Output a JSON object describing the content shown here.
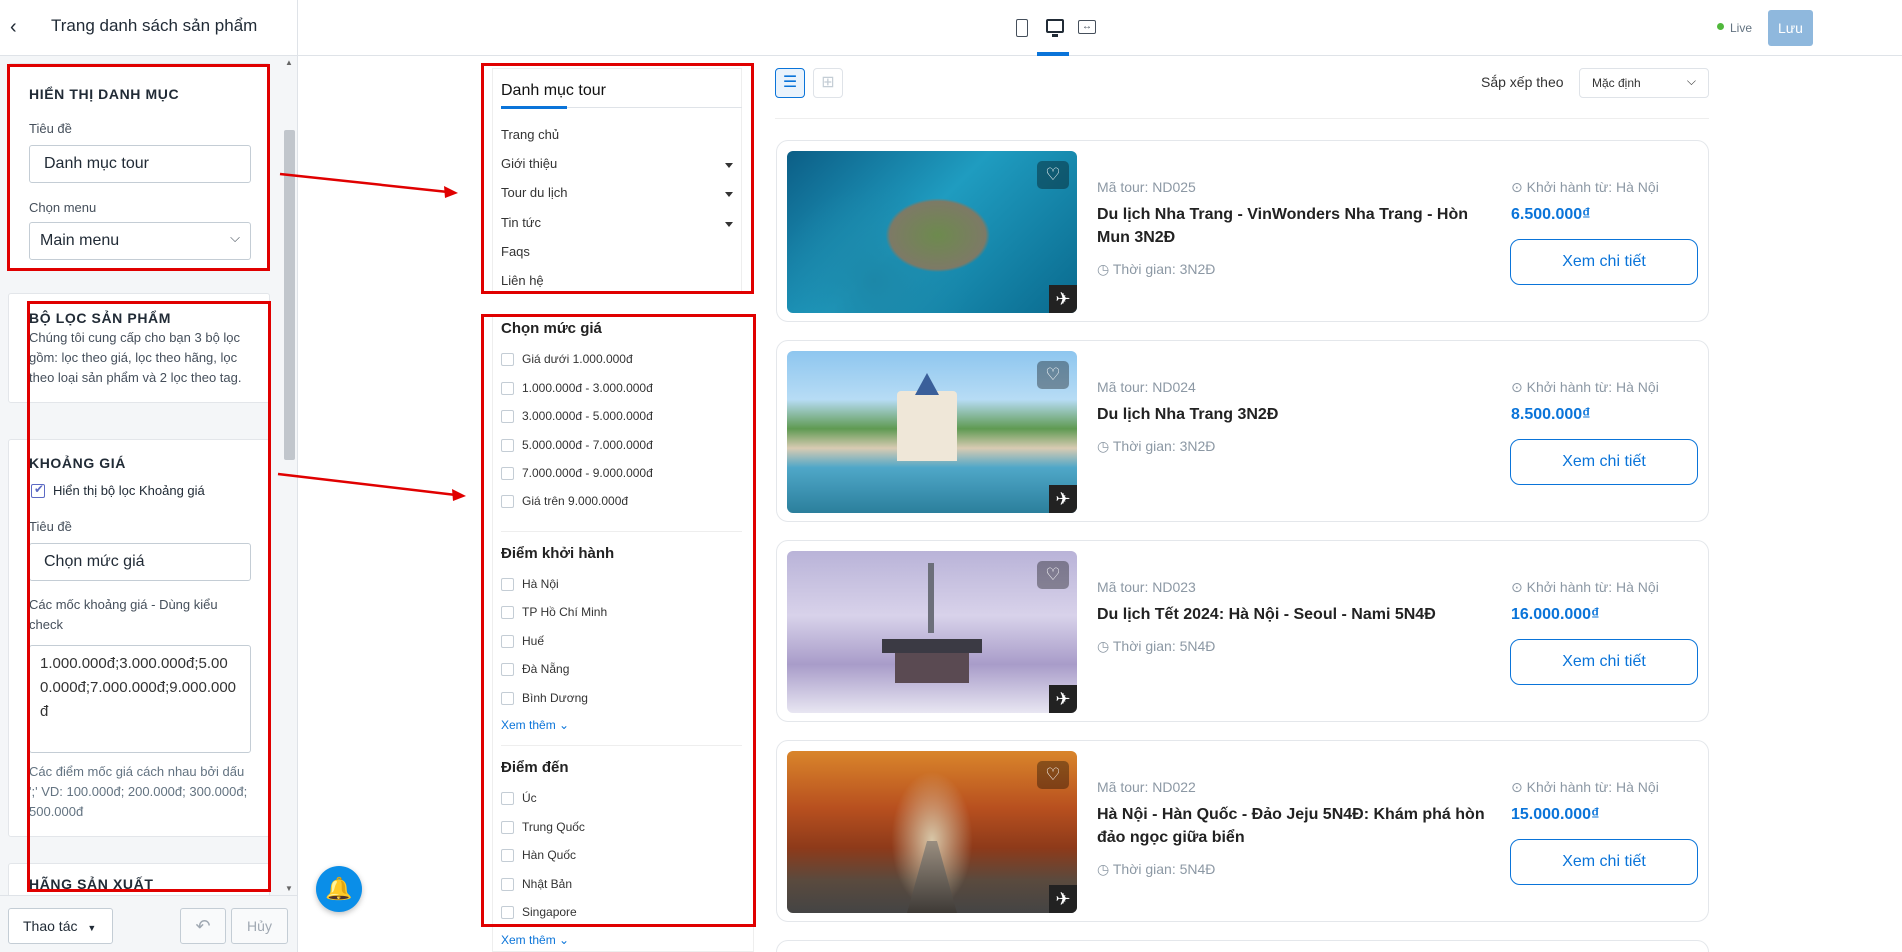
{
  "editor": {
    "title": "Trang danh sách sản phẩm",
    "display_category": {
      "heading": "HIỂN THỊ DANH MỤC",
      "title_label": "Tiêu đề",
      "title_value": "Danh mục tour",
      "menu_label": "Chọn menu",
      "menu_value": "Main menu"
    },
    "filter_section": {
      "heading": "BỘ LỌC SẢN PHẨM",
      "description": "Chúng tôi cung cấp cho bạn 3 bộ lọc gồm: lọc theo giá, lọc theo hãng, lọc theo loại sản phẩm và 2 lọc theo tag."
    },
    "price_range": {
      "heading": "KHOẢNG GIÁ",
      "checkbox_label": "Hiển thị bộ lọc Khoảng giá",
      "checkbox_checked": true,
      "title_label": "Tiêu đề",
      "title_value": "Chọn mức giá",
      "steps_label": "Các mốc khoảng giá - Dùng kiểu check",
      "steps_value": "1.000.000đ;3.000.000đ;5.000.000đ;7.000.000đ;9.000.000đ",
      "help": "Các điểm mốc giá cách nhau bởi dấu ';' VD: 100.000đ; 200.000đ; 300.000đ; 500.000đ"
    },
    "brand_heading": "HÃNG SẢN XUẤT",
    "footer": {
      "actions_label": "Thao tác",
      "cancel_label": "Hủy"
    }
  },
  "topbar": {
    "live_label": "Live",
    "save_label": "Lưu"
  },
  "sidebar": {
    "category_title": "Danh mục tour",
    "category_items": [
      {
        "label": "Trang chủ",
        "has_children": false
      },
      {
        "label": "Giới thiệu",
        "has_children": true
      },
      {
        "label": "Tour du lịch",
        "has_children": true
      },
      {
        "label": "Tin tức",
        "has_children": true
      },
      {
        "label": "Faqs",
        "has_children": false
      },
      {
        "label": "Liên hệ",
        "has_children": false
      }
    ],
    "price_filter": {
      "title": "Chọn mức giá",
      "options": [
        "Giá dưới 1.000.000đ",
        "1.000.000đ - 3.000.000đ",
        "3.000.000đ - 5.000.000đ",
        "5.000.000đ - 7.000.000đ",
        "7.000.000đ - 9.000.000đ",
        "Giá trên 9.000.000đ"
      ]
    },
    "departure_filter": {
      "title": "Điểm khởi hành",
      "options": [
        "Hà Nội",
        "TP Hồ Chí Minh",
        "Huế",
        "Đà Nẵng",
        "Bình Dương"
      ],
      "more_label": "Xem thêm"
    },
    "destination_filter": {
      "title": "Điểm đến",
      "options": [
        "Úc",
        "Trung Quốc",
        "Hàn Quốc",
        "Nhật Bản",
        "Singapore"
      ],
      "more_label": "Xem thêm"
    }
  },
  "toolbar": {
    "sort_label": "Sắp xếp theo",
    "sort_value": "Mặc định"
  },
  "tours": [
    {
      "code": "Mã tour: ND025",
      "name": "Du lịch Nha Trang - VinWonders Nha Trang - Hòn Mun 3N2Đ",
      "time": "Thời gian: 3N2Đ",
      "departure": "Khởi hành từ: Hà Nội",
      "price": "6.500.000₫",
      "button": "Xem chi tiết"
    },
    {
      "code": "Mã tour: ND024",
      "name": "Du lịch Nha Trang 3N2Đ",
      "time": "Thời gian: 3N2Đ",
      "departure": "Khởi hành từ: Hà Nội",
      "price": "8.500.000₫",
      "button": "Xem chi tiết"
    },
    {
      "code": "Mã tour: ND023",
      "name": "Du lịch Tết 2024: Hà Nội - Seoul - Nami 5N4Đ",
      "time": "Thời gian: 5N4Đ",
      "departure": "Khởi hành từ: Hà Nội",
      "price": "16.000.000₫",
      "button": "Xem chi tiết"
    },
    {
      "code": "Mã tour: ND022",
      "name": "Hà Nội - Hàn Quốc - Đảo Jeju 5N4Đ: Khám phá hòn đảo ngọc giữa biển",
      "time": "Thời gian: 5N4Đ",
      "departure": "Khởi hành từ: Hà Nội",
      "price": "15.000.000₫",
      "button": "Xem chi tiết"
    }
  ],
  "colors": {
    "accent": "#0a74d9",
    "annotation": "#e00000",
    "live_dot": "#50b83c",
    "save_button": "#8fb8dd"
  }
}
